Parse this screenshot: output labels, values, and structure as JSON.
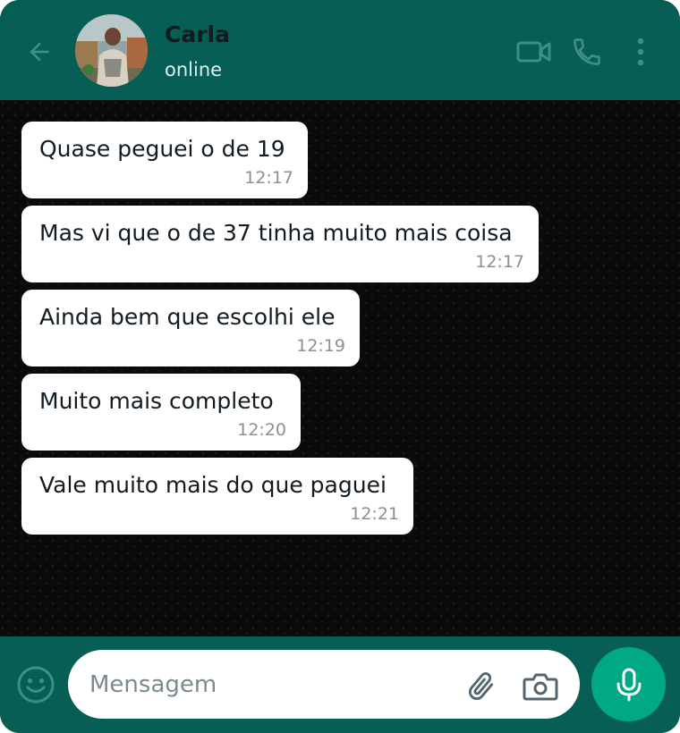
{
  "header": {
    "name": "Carla",
    "status": "online"
  },
  "messages": [
    {
      "text": "Quase peguei o de 19",
      "time": "12:17"
    },
    {
      "text": "Mas vi que o de 37 tinha muito mais coisa",
      "time": "12:17"
    },
    {
      "text": "Ainda bem que escolhi ele",
      "time": "12:19"
    },
    {
      "text": "Muito mais completo",
      "time": "12:20"
    },
    {
      "text": "Vale muito mais do que paguei",
      "time": "12:21"
    }
  ],
  "composer": {
    "placeholder": "Mensagem"
  },
  "colors": {
    "header": "#075e54",
    "accent": "#00a884",
    "bubble": "#ffffff"
  },
  "icons": [
    "back-arrow-icon",
    "video-call-icon",
    "phone-icon",
    "more-vert-icon",
    "emoji-icon",
    "attach-icon",
    "camera-icon",
    "mic-icon"
  ]
}
